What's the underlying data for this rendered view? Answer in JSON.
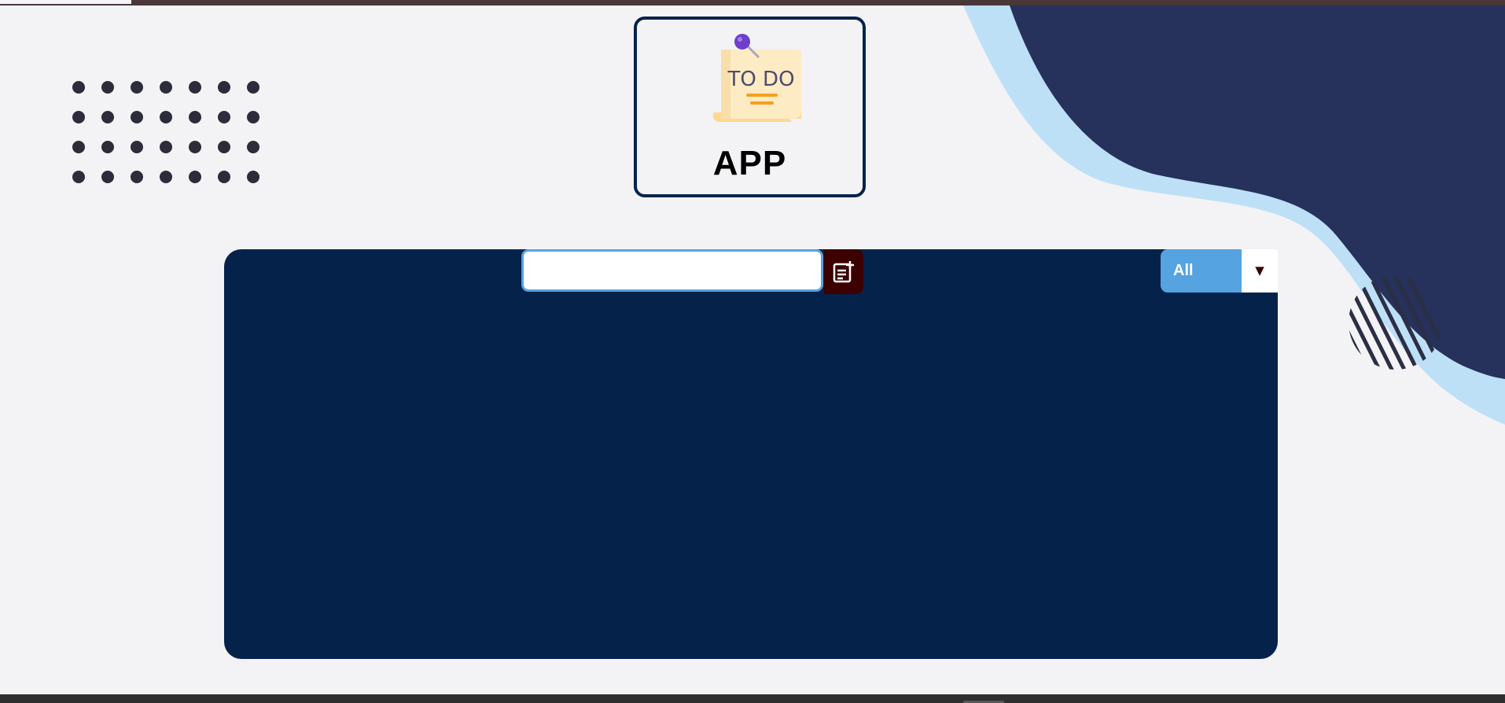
{
  "app": {
    "logo_icon": "todo-note-icon",
    "logo_note_text": "TO DO",
    "title": "APP"
  },
  "todo_form": {
    "input_value": "",
    "input_placeholder": "",
    "add_button_icon": "add-note-icon"
  },
  "filter": {
    "selected": "All",
    "arrow_glyph": "▼"
  },
  "todo_list": {
    "items": []
  },
  "colors": {
    "panel": "#05234a",
    "accent_blue": "#55a3e1",
    "add_button": "#3c0000",
    "wave_dark": "#26325b",
    "wave_light": "#bde0f7",
    "background": "#f3f3f5"
  }
}
